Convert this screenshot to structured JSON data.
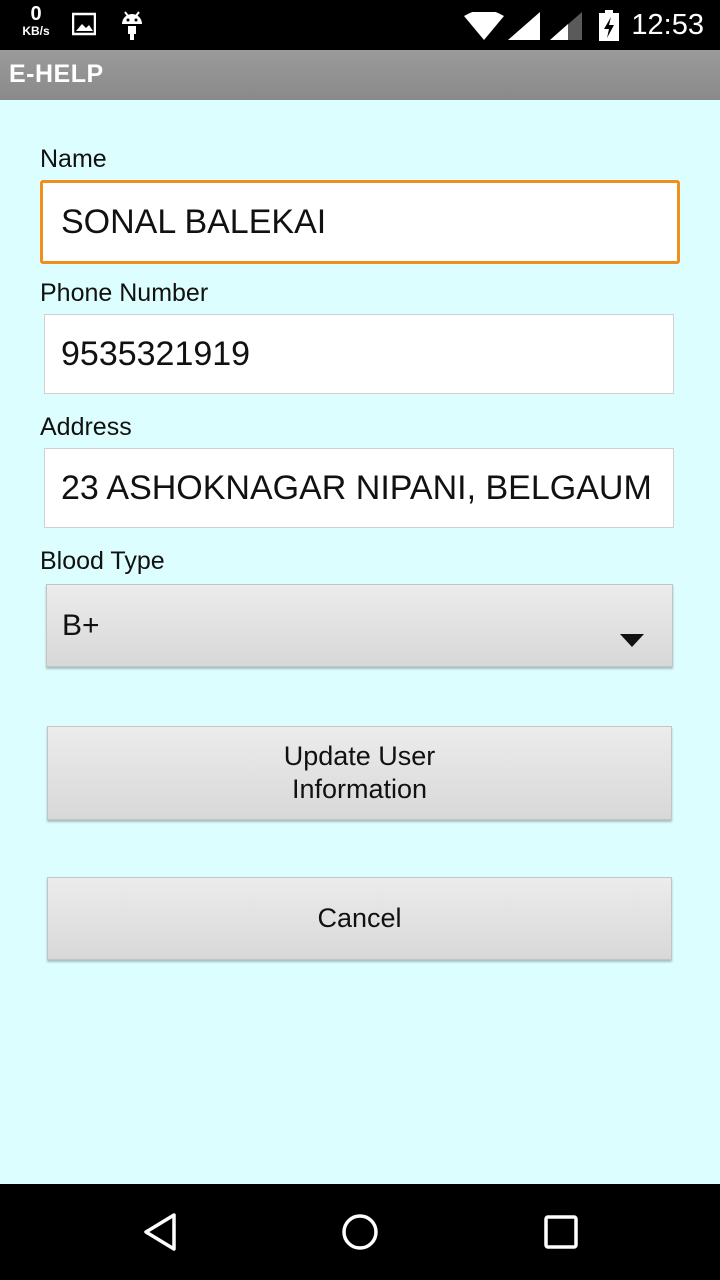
{
  "status_bar": {
    "net_speed_value": "0",
    "net_speed_unit": "KB/s",
    "time": "12:53",
    "icons": [
      "image-icon",
      "android-icon",
      "wifi-icon",
      "signal-icon",
      "signal-weak-icon",
      "battery-charging-icon"
    ]
  },
  "app_bar": {
    "title": "E-HELP",
    "color": "#929292"
  },
  "form": {
    "name_label": "Name",
    "name_value": "SONAL BALEKAI",
    "phone_label": "Phone Number",
    "phone_value": "9535321919",
    "address_label": "Address",
    "address_value": "23 ASHOKNAGAR NIPANI, BELGAUM",
    "blood_label": "Blood Type",
    "blood_value": "B+",
    "update_button": "Update User\n Information",
    "cancel_button": "Cancel",
    "background_color": "#ddfefe",
    "focus_color": "#f0901c"
  },
  "nav_bar": {
    "icons": [
      "back-icon",
      "home-icon",
      "recents-icon"
    ]
  }
}
